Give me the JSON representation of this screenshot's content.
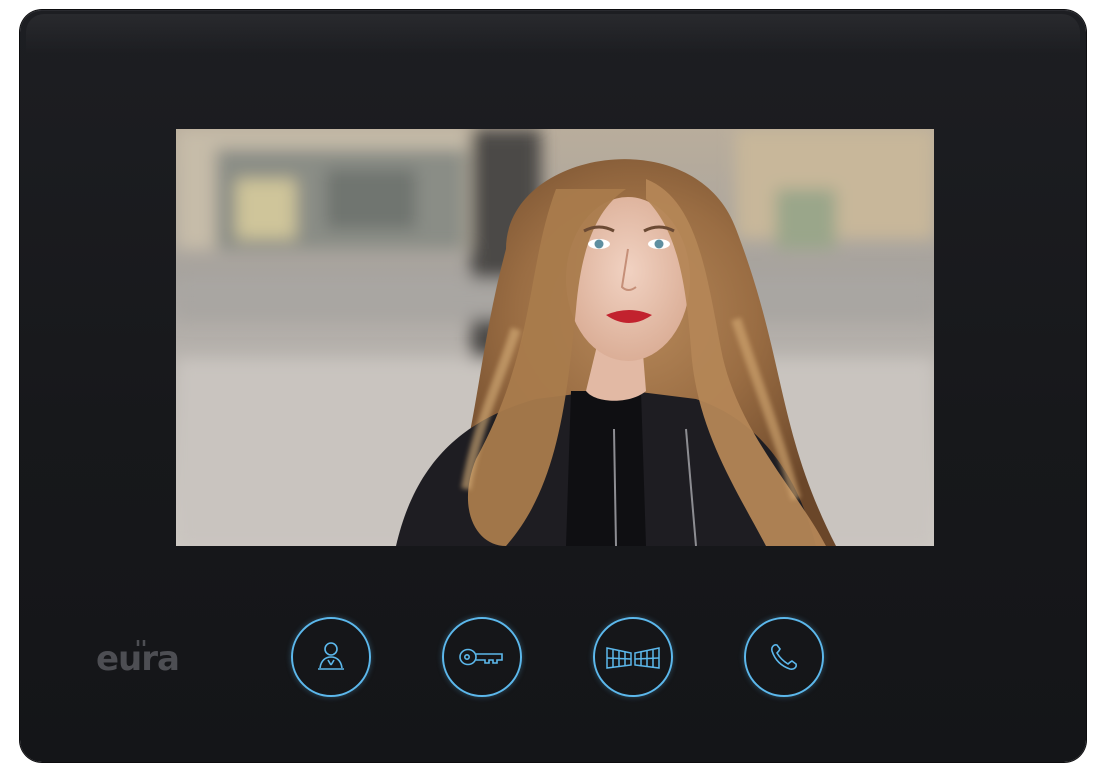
{
  "device": {
    "brand": "eura",
    "accent_color": "#5cb8ec",
    "body_color": "#1a1b1f"
  },
  "screen": {
    "content": "video-feed"
  },
  "buttons": [
    {
      "icon": "person-monitor-icon"
    },
    {
      "icon": "key-icon"
    },
    {
      "icon": "gate-icon"
    },
    {
      "icon": "handset-icon"
    }
  ]
}
